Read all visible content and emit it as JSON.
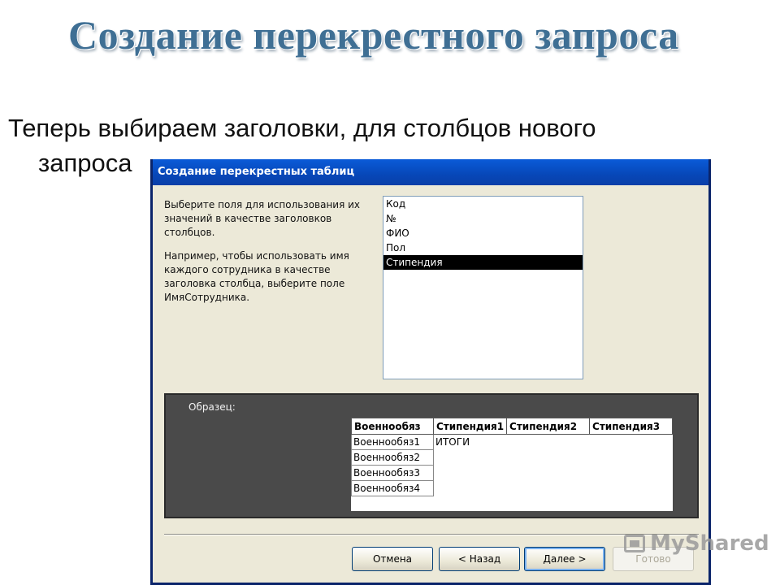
{
  "slide": {
    "title": "Создание перекрестного запроса",
    "text_line1": "Теперь выбираем заголовки, для столбцов нового",
    "text_line2": "запроса"
  },
  "dialog": {
    "title": "Создание перекрестных таблиц",
    "instruction_1": "Выберите поля для использования их значений в качестве заголовков столбцов.",
    "instruction_2": "Например, чтобы использовать имя каждого сотрудника в качестве заголовка столбца, выберите поле ИмяСотрудника.",
    "fields": [
      {
        "label": "Код",
        "selected": false
      },
      {
        "label": "№",
        "selected": false
      },
      {
        "label": "ФИО",
        "selected": false
      },
      {
        "label": "Пол",
        "selected": false
      },
      {
        "label": "Стипендия",
        "selected": true
      }
    ],
    "sample": {
      "label": "Образец:",
      "headers": [
        "Военнообяз",
        "Стипендия1",
        "Стипендия2",
        "Стипендия3"
      ],
      "rows": [
        "Военнообяз1",
        "Военнообяз2",
        "Военнообяз3",
        "Военнообяз4"
      ],
      "totals_label": "ИТОГИ"
    },
    "buttons": {
      "cancel": "Отмена",
      "back": "< Назад",
      "next": "Далее >",
      "finish": "Готово"
    }
  },
  "watermark": {
    "text": "MyShared"
  }
}
